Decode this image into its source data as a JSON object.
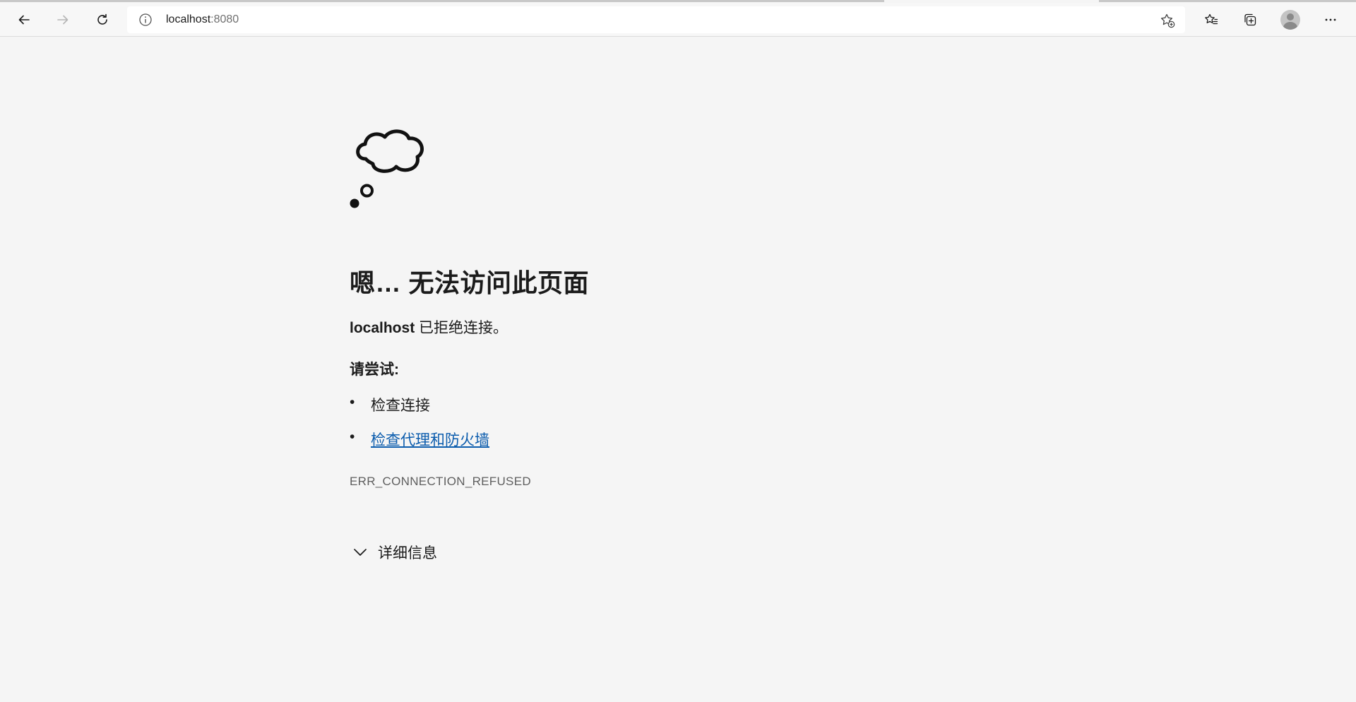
{
  "browser": {
    "address": {
      "host": "localhost",
      "port": ":8080"
    },
    "buttons": {
      "back": "back-arrow-icon",
      "forward": "forward-arrow-icon",
      "refresh": "refresh-icon",
      "favorite_add": "star-add-icon",
      "favorites": "favorites-list-icon",
      "collections": "collections-icon",
      "profile": "profile-avatar",
      "menu": "more-menu-icon"
    }
  },
  "error_page": {
    "heading": "嗯… 无法访问此页面",
    "host": "localhost",
    "message": " 已拒绝连接。",
    "try_label": "请尝试:",
    "suggestions": [
      {
        "text": "检查连接",
        "is_link": false
      },
      {
        "text": "检查代理和防火墙",
        "is_link": true
      }
    ],
    "bullet": "•",
    "error_code": "ERR_CONNECTION_REFUSED",
    "details_label": "详细信息",
    "link_color": "#0b5cad"
  }
}
